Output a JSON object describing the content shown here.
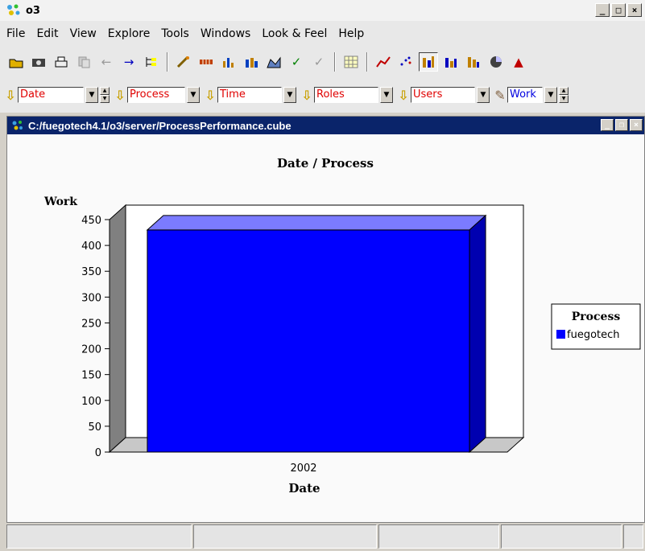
{
  "window": {
    "title": "o3",
    "buttons": [
      "_",
      "□",
      "×"
    ]
  },
  "menu": [
    "File",
    "Edit",
    "View",
    "Explore",
    "Tools",
    "Windows",
    "Look & Feel",
    "Help"
  ],
  "toolbar": {
    "icons": [
      "open-icon",
      "camera-icon",
      "print-icon",
      "copy-icon",
      "back-icon",
      "forward-icon",
      "tree-icon",
      "wand-icon",
      "grid-icon",
      "bar-chart-icon",
      "stacked-bar-icon",
      "area-icon",
      "check-icon",
      "uncheck-icon",
      "table-icon",
      "line-chart-icon",
      "scatter-icon",
      "bar-3d-icon",
      "bar-3d-alt-icon",
      "bar-3d-grouped-icon",
      "pie-icon",
      "more-icon"
    ]
  },
  "dimensions": [
    {
      "label": "Date"
    },
    {
      "label": "Process"
    },
    {
      "label": "Time"
    },
    {
      "label": "Roles"
    },
    {
      "label": "Users"
    }
  ],
  "measure": {
    "label": "Work"
  },
  "document": {
    "title": "C:/fuegotech4.1/o3/server/ProcessPerformance.cube"
  },
  "chart_data": {
    "type": "bar",
    "title": "Date / Process",
    "xlabel": "Date",
    "ylabel": "Work",
    "categories": [
      "2002"
    ],
    "series": [
      {
        "name": "fuegotech",
        "values": [
          430
        ],
        "color": "#0000ff"
      }
    ],
    "ylim": [
      0,
      450
    ],
    "yticks": [
      0,
      50,
      100,
      150,
      200,
      250,
      300,
      350,
      400,
      450
    ],
    "legend": {
      "title": "Process",
      "placement": "right"
    },
    "style": "3d"
  }
}
